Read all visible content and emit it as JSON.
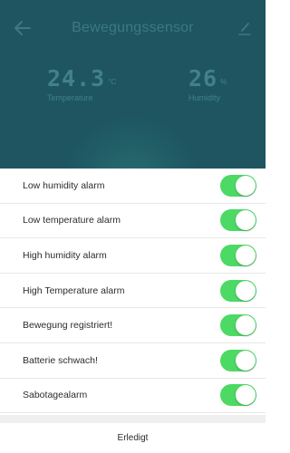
{
  "header": {
    "title": "Bewegungssensor",
    "back_icon": "back-arrow-icon",
    "edit_icon": "edit-pen-icon",
    "background_color": "#1e5561",
    "text_color": "#42818a"
  },
  "readings": {
    "temperature": {
      "value": "24.3",
      "unit": "°C",
      "label": "Temperature"
    },
    "humidity": {
      "value": "26",
      "unit": "%",
      "label": "Humidity"
    }
  },
  "alarms": [
    {
      "label": "Low humidity alarm",
      "enabled": true
    },
    {
      "label": "Low temperature alarm",
      "enabled": true
    },
    {
      "label": "High humidity alarm",
      "enabled": true
    },
    {
      "label": "High Temperature alarm",
      "enabled": true
    },
    {
      "label": "Bewegung registriert!",
      "enabled": true
    },
    {
      "label": "Batterie schwach!",
      "enabled": true
    },
    {
      "label": "Sabotagealarm",
      "enabled": true
    }
  ],
  "toggle_on_color": "#4cd964",
  "done_label": "Erledigt"
}
